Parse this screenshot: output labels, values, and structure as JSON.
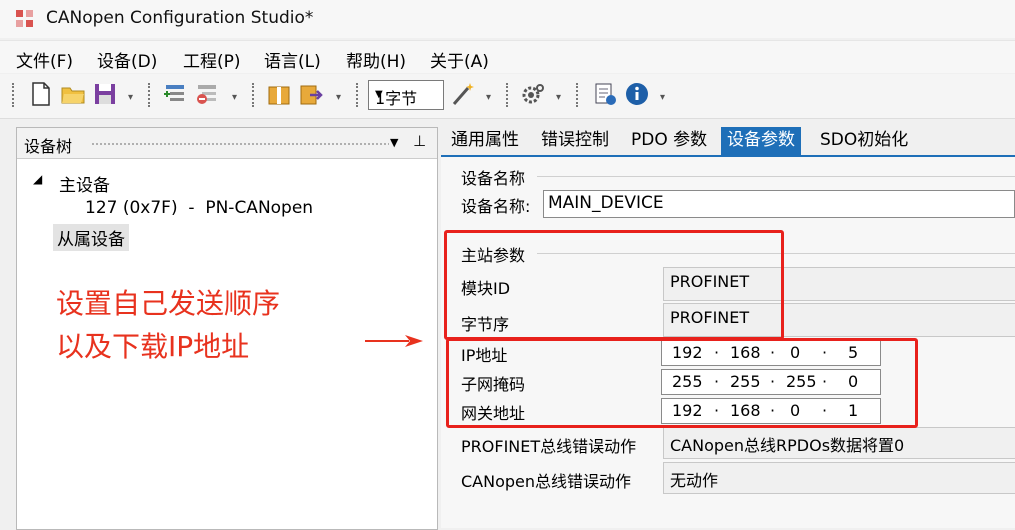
{
  "window": {
    "title": "CANopen Configuration Studio*"
  },
  "menu": [
    "文件(F)",
    "设备(D)",
    "工程(P)",
    "语言(L)",
    "帮助(H)",
    "关于(A)"
  ],
  "toolbar": {
    "byte_combo": "1字节"
  },
  "device_tree": {
    "title": "设备树",
    "root": "主设备",
    "node": "127 (0x7F)  -  PN-CANopen",
    "slave": "从属设备"
  },
  "annotation": {
    "line1": "设置自己发送顺序",
    "line2": "以及下载IP地址"
  },
  "tabs": [
    "通用属性",
    "错误控制",
    "PDO 参数",
    "设备参数",
    "SDO初始化"
  ],
  "active_tab": "设备参数",
  "device_name": {
    "group": "设备名称",
    "label": "设备名称:",
    "value": "MAIN_DEVICE"
  },
  "master": {
    "group": "主站参数",
    "module_id_label": "模块ID",
    "module_id": "PROFINET",
    "byte_order_label": "字节序",
    "byte_order": "PROFINET",
    "ip_label": "IP地址",
    "ip": [
      "192",
      "168",
      "0",
      "5"
    ],
    "mask_label": "子网掩码",
    "mask": [
      "255",
      "255",
      "255",
      "0"
    ],
    "gateway_label": "网关地址",
    "gateway": [
      "192",
      "168",
      "0",
      "1"
    ],
    "profinet_err_label": "PROFINET总线错误动作",
    "profinet_err": "CANopen总线RPDOs数据将置0",
    "canopen_err_label": "CANopen总线错误动作",
    "canopen_err": "无动作"
  },
  "colors": {
    "accent": "#1e6fb8",
    "annotation_red": "#e8321e"
  }
}
